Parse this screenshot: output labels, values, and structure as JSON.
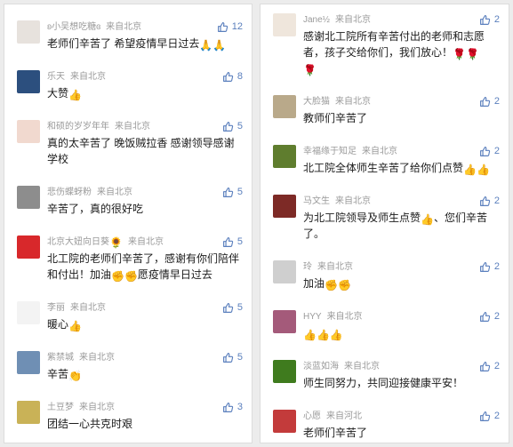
{
  "colors": {
    "accent": "#5a7fbd",
    "meta": "#9a9a9a",
    "text": "#1a1a1a",
    "background": "#ececec",
    "panel": "#ffffff"
  },
  "icons": {
    "like": "thumb-up-outline-icon"
  },
  "left_comments": [
    {
      "name": "ʚ小吴想吃糖ɞ",
      "location": "来自北京",
      "text": "老师们辛苦了 希望疫情早日过去",
      "emoji": "🙏🙏",
      "likes": "12",
      "avatar_icon": "avatar-girl-icon",
      "avatar_color": "#e7e2dd"
    },
    {
      "name": "乐天",
      "location": "来自北京",
      "text": "大赞",
      "emoji": "👍",
      "likes": "8",
      "avatar_icon": "avatar-sunflower-icon",
      "avatar_color": "#2c4f7e"
    },
    {
      "name": "和硕的岁岁年年",
      "location": "来自北京",
      "text": "真的太辛苦了 晚饭贼拉香 感谢领导感谢学校",
      "emoji": "",
      "likes": "5",
      "avatar_icon": "avatar-person-icon",
      "avatar_color": "#f1d9cf"
    },
    {
      "name": "悲伤蝶蚜粉",
      "location": "来自北京",
      "text": "辛苦了，真的很好吃",
      "emoji": "",
      "likes": "5",
      "avatar_icon": "avatar-person-icon",
      "avatar_color": "#8d8d8d"
    },
    {
      "name": "北京大妞向日葵",
      "name_emoji": "🌻",
      "location": "来自北京",
      "text": "北工院的老师们辛苦了，感谢有你们陪伴和付出！加油",
      "emoji": "✊✊",
      "text_after": "愿疫情早日过去",
      "likes": "5",
      "avatar_icon": "avatar-flag-icon",
      "avatar_color": "#d8282b"
    },
    {
      "name": "李丽",
      "location": "来自北京",
      "text": "暖心",
      "emoji": "👍",
      "likes": "5",
      "avatar_icon": "avatar-cartoon-icon",
      "avatar_color": "#f3f3f3"
    },
    {
      "name": "紫禁城",
      "location": "来自北京",
      "text": "辛苦",
      "emoji": "👏",
      "likes": "5",
      "avatar_icon": "avatar-city-icon",
      "avatar_color": "#6f8fb4"
    },
    {
      "name": "土豆梦",
      "location": "来自北京",
      "text": "团结一心共克时艰",
      "emoji": "",
      "likes": "3",
      "avatar_icon": "avatar-car-icon",
      "avatar_color": "#c9b257"
    }
  ],
  "right_comments": [
    {
      "name": "Jane½",
      "location": "来自北京",
      "text": "感谢北工院所有辛苦付出的老师和志愿者，孩子交给你们，我们放心！",
      "emoji": "🌹🌹",
      "emoji2": "🌹",
      "likes": "2",
      "avatar_icon": "avatar-girl-icon",
      "avatar_color": "#efe6dc"
    },
    {
      "name": "大脸猫",
      "location": "来自北京",
      "text": "教师们辛苦了",
      "emoji": "",
      "likes": "2",
      "avatar_icon": "avatar-cat-icon",
      "avatar_color": "#b9a98a"
    },
    {
      "name": "幸福缘于知足",
      "location": "来自北京",
      "text": "北工院全体师生辛苦了给你们点赞",
      "emoji": "👍👍",
      "likes": "2",
      "avatar_icon": "avatar-sunflower-icon",
      "avatar_color": "#5f7d2e"
    },
    {
      "name": "马文生",
      "location": "来自北京",
      "text": "为北工院领导及师生点赞",
      "emoji": "👍",
      "text_after": "、您们辛苦了。",
      "likes": "2",
      "avatar_icon": "avatar-man-icon",
      "avatar_color": "#7d2a26"
    },
    {
      "name": "玲",
      "location": "来自北京",
      "text": "加油",
      "emoji": "✊✊",
      "likes": "2",
      "avatar_icon": "avatar-dogs-icon",
      "avatar_color": "#cfcfcf"
    },
    {
      "name": "HYY",
      "location": "来自北京",
      "text": "",
      "emoji": "👍👍👍",
      "likes": "2",
      "avatar_icon": "avatar-flower-icon",
      "avatar_color": "#a45a7a"
    },
    {
      "name": "淡蓝如海",
      "location": "来自北京",
      "text": "师生同努力，共同迎接健康平安！",
      "emoji": "",
      "likes": "2",
      "avatar_icon": "avatar-leaf-icon",
      "avatar_color": "#3f7b1e"
    },
    {
      "name": "心愿",
      "location": "来自河北",
      "text": "老师们辛苦了",
      "emoji": "",
      "likes": "2",
      "avatar_icon": "avatar-person-icon",
      "avatar_color": "#c33b3b"
    }
  ]
}
